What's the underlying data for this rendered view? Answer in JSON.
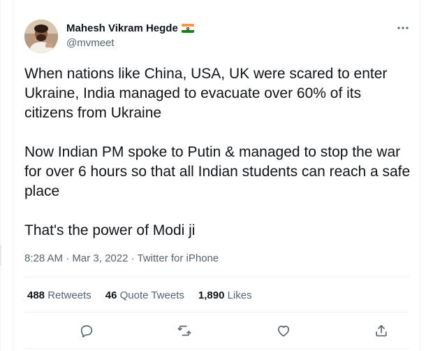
{
  "author": {
    "name": "Mahesh Vikram Hegde",
    "handle": "@mvmeet",
    "flag_icon": "india-flag-icon"
  },
  "tweet": {
    "paragraphs": [
      "When nations like China, USA, UK were scared to enter Ukraine, India managed to evacuate over 60% of its citizens from Ukraine",
      "Now Indian PM spoke to Putin & managed to stop the war for over 6 hours so that all Indian students can reach a safe place",
      "That's the power of Modi ji"
    ],
    "time": "8:28 AM",
    "separator": "·",
    "date": "Mar 3, 2022",
    "source": "Twitter for iPhone"
  },
  "stats": {
    "retweets": {
      "count": "488",
      "label": "Retweets"
    },
    "quotes": {
      "count": "46",
      "label": "Quote Tweets"
    },
    "likes": {
      "count": "1,890",
      "label": "Likes"
    }
  },
  "actions": [
    "reply-icon",
    "retweet-icon",
    "like-icon",
    "share-icon"
  ],
  "colors": {
    "text": "#0f1419",
    "secondary": "#536471",
    "divider": "#eff3f4"
  }
}
